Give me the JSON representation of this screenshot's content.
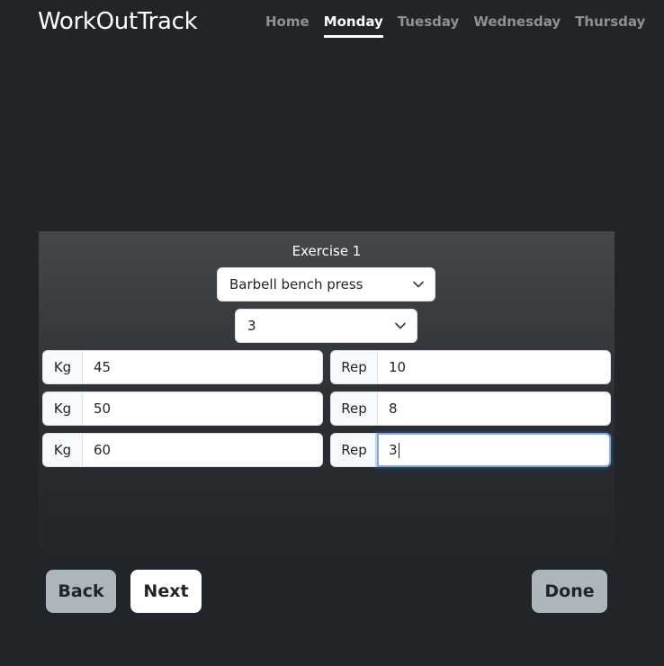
{
  "navbar": {
    "brand": "WorkOutTrack",
    "items": [
      {
        "label": "Home",
        "active": false
      },
      {
        "label": "Monday",
        "active": true
      },
      {
        "label": "Tuesday",
        "active": false
      },
      {
        "label": "Wednesday",
        "active": false
      },
      {
        "label": "Thursday",
        "active": false
      }
    ]
  },
  "exercise": {
    "title": "Exercise 1",
    "selected_exercise": "Barbell bench press",
    "selected_sets": "3",
    "sets": [
      {
        "kg_label": "Kg",
        "kg": "45",
        "rep_label": "Rep",
        "reps": "10"
      },
      {
        "kg_label": "Kg",
        "kg": "50",
        "rep_label": "Rep",
        "reps": "8"
      },
      {
        "kg_label": "Kg",
        "kg": "60",
        "rep_label": "Rep",
        "reps": "3"
      }
    ]
  },
  "buttons": {
    "back": "Back",
    "next": "Next",
    "done": "Done"
  },
  "icons": {
    "select_arrow": "chevron-down-icon"
  },
  "colors": {
    "background": "#212529",
    "secondary_button": "#adb5bd",
    "focus_ring": "#86a8d8"
  }
}
